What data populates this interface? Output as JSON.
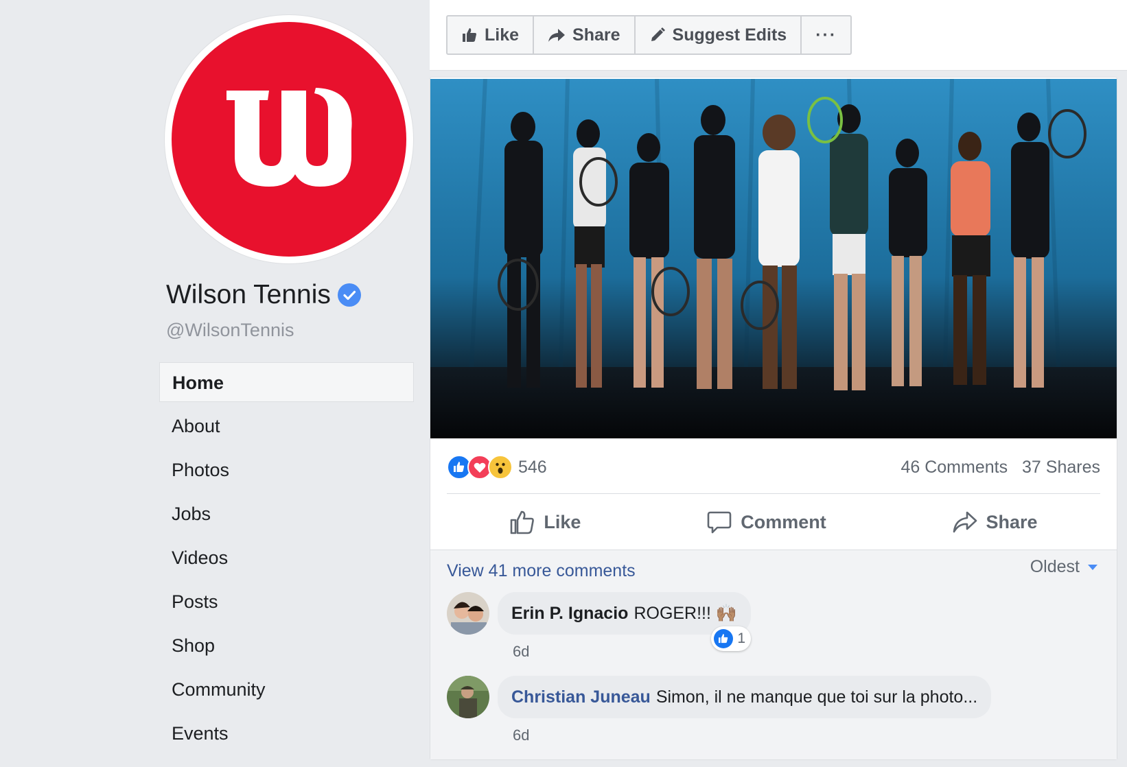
{
  "page": {
    "name": "Wilson Tennis",
    "handle": "@WilsonTennis",
    "logo_letter": "W",
    "brand_color": "#e8112d",
    "verified_color": "#4a8cf5"
  },
  "nav": {
    "items": [
      {
        "label": "Home",
        "active": true
      },
      {
        "label": "About"
      },
      {
        "label": "Photos"
      },
      {
        "label": "Jobs"
      },
      {
        "label": "Videos"
      },
      {
        "label": "Posts"
      },
      {
        "label": "Shop"
      },
      {
        "label": "Community"
      },
      {
        "label": "Events"
      }
    ]
  },
  "page_actions": {
    "like": "Like",
    "share": "Share",
    "suggest_edits": "Suggest Edits",
    "more": "···"
  },
  "post": {
    "reactions": [
      "like",
      "love",
      "wow"
    ],
    "reaction_count": "546",
    "comments_count": "46 Comments",
    "shares_count": "37 Shares",
    "actions": {
      "like": "Like",
      "comment": "Comment",
      "share": "Share"
    },
    "view_more": "View 41 more comments",
    "sort": "Oldest",
    "comments": [
      {
        "author": "Erin P. Ignacio",
        "text": "ROGER!!! 🙌🏽",
        "time": "6d",
        "likes": "1"
      },
      {
        "author": "Christian Juneau",
        "text": "Simon, il ne manque que toi sur la photo...",
        "time": "6d"
      }
    ]
  }
}
